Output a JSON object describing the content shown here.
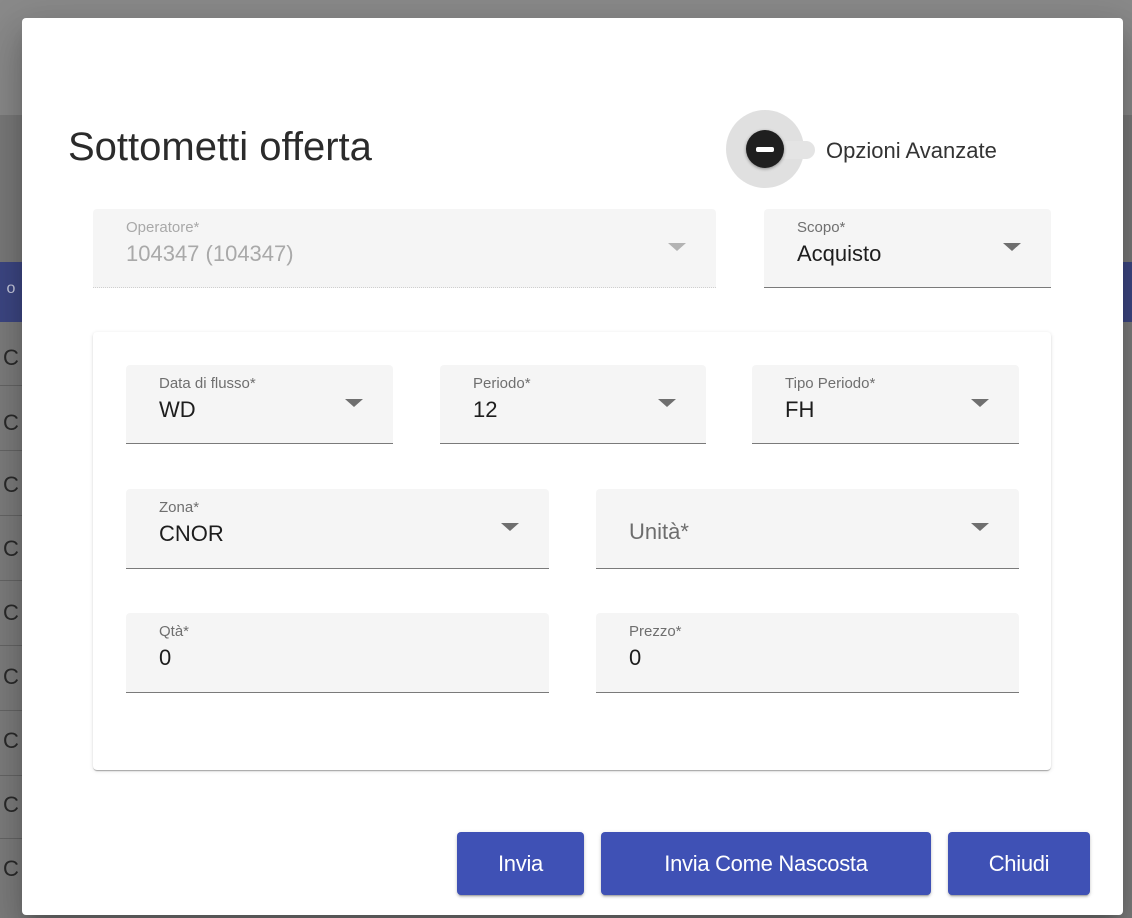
{
  "background": {
    "row_letters": [
      "o",
      "C",
      "C",
      "C",
      "C",
      "C",
      "C",
      "C",
      "C",
      "C"
    ]
  },
  "dialog": {
    "title": "Sottometti offerta",
    "advanced_toggle": {
      "label": "Opzioni Avanzate",
      "checked": false
    },
    "operatore": {
      "label": "Operatore*",
      "value": "104347 (104347)",
      "disabled": true
    },
    "scopo": {
      "label": "Scopo*",
      "value": "Acquisto"
    },
    "data_flusso": {
      "label": "Data di flusso*",
      "value": "WD"
    },
    "periodo": {
      "label": "Periodo*",
      "value": "12"
    },
    "tipo_periodo": {
      "label": "Tipo Periodo*",
      "value": "FH"
    },
    "zona": {
      "label": "Zona*",
      "value": "CNOR"
    },
    "unita": {
      "placeholder": "Unità*"
    },
    "qta": {
      "label": "Qtà*",
      "value": "0"
    },
    "prezzo": {
      "label": "Prezzo*",
      "value": "0"
    },
    "buttons": {
      "invia": "Invia",
      "invia_nascosta": "Invia Come Nascosta",
      "chiudi": "Chiudi"
    }
  },
  "colors": {
    "primary": "#3f51b5",
    "field_bg": "#f5f5f5"
  }
}
